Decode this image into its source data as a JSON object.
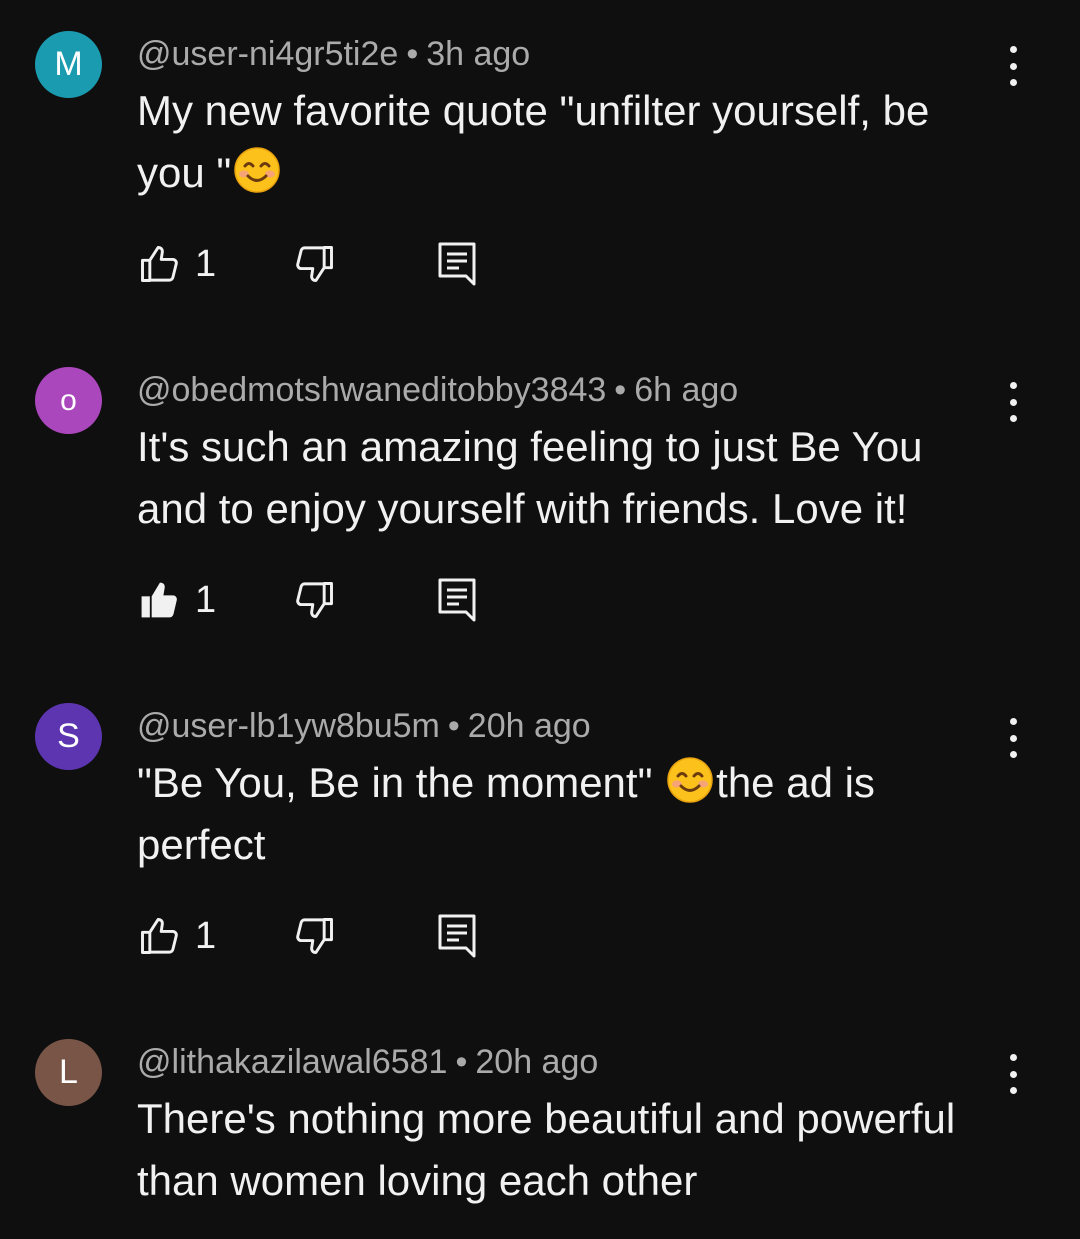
{
  "comments": [
    {
      "avatar_letter": "M",
      "avatar_color": "#1a9bb0",
      "handle": "@user-ni4gr5ti2e",
      "time": "3h ago",
      "text_parts": [
        "My new favorite quote \"unfilter yourself,  be you \"",
        ""
      ],
      "emoji": "smiling-face-emoji",
      "likes": "1",
      "liked": false
    },
    {
      "avatar_letter": "o",
      "avatar_color": "#ab47bc",
      "handle": "@obedmotshwaneditobby3843",
      "time": "6h ago",
      "text_parts": [
        "It's such an amazing feeling to just Be You and to enjoy yourself with friends. Love it!"
      ],
      "likes": "1",
      "liked": true
    },
    {
      "avatar_letter": "S",
      "avatar_color": "#5e35b1",
      "handle": "@user-lb1yw8bu5m",
      "time": "20h ago",
      "text_parts": [
        "\"Be You, Be in the moment\" ",
        "the ad is perfect"
      ],
      "emoji": "smiling-face-emoji",
      "likes": "1",
      "liked": false
    },
    {
      "avatar_letter": "L",
      "avatar_color": "#795548",
      "handle": "@lithakazilawal6581",
      "time": "20h ago",
      "text_parts": [
        "There's nothing more beautiful and powerful than women loving each other"
      ]
    }
  ],
  "separator": "•"
}
